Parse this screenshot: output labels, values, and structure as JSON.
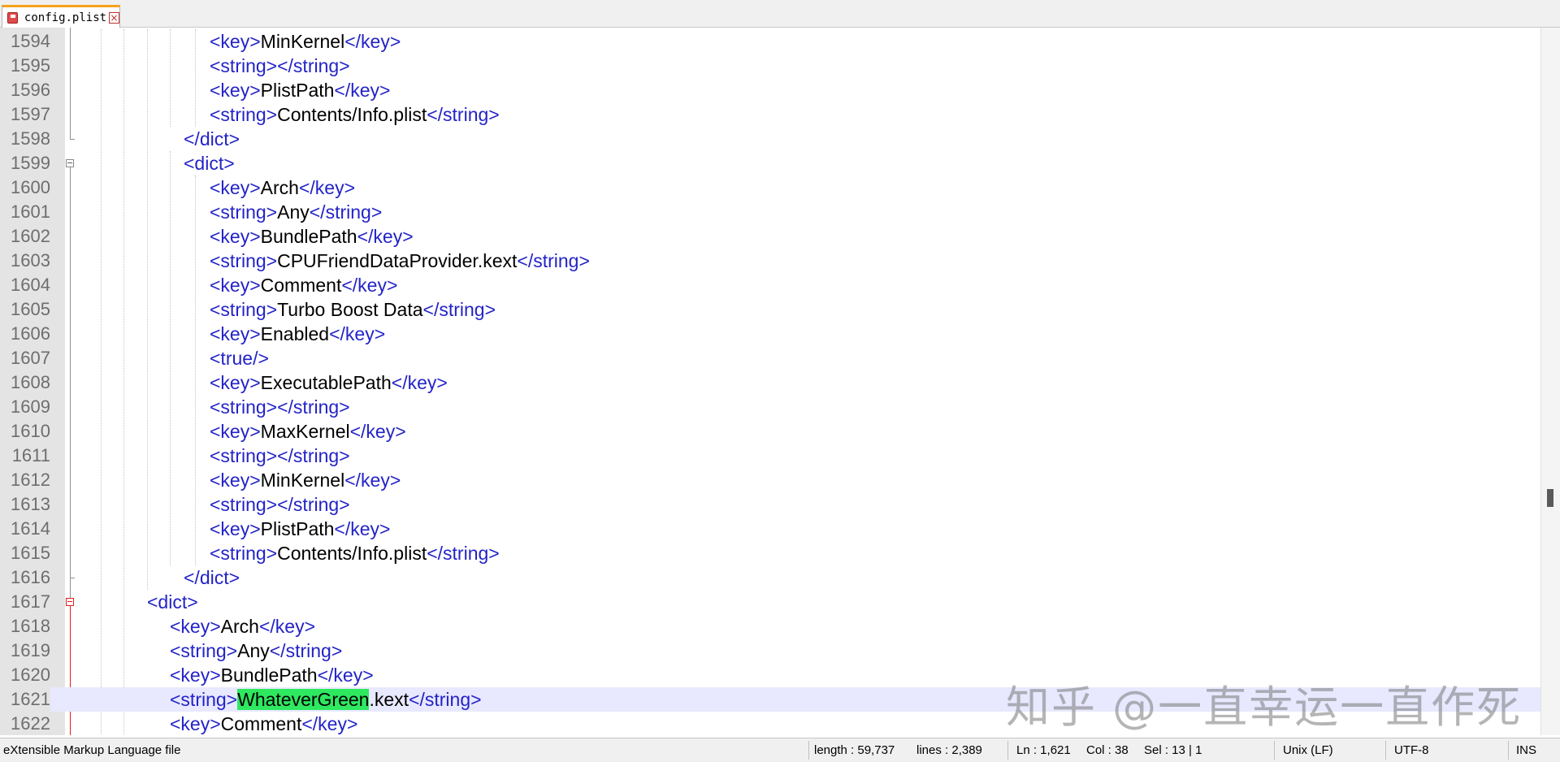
{
  "tab": {
    "label": "config.plist",
    "close": "×"
  },
  "editor": {
    "lines": [
      {
        "num": "1594",
        "indent": 3,
        "parts": [
          {
            "t": "tag",
            "v": "<key>"
          },
          {
            "t": "text",
            "v": "MinKernel"
          },
          {
            "t": "tag",
            "v": "</key>"
          }
        ]
      },
      {
        "num": "1595",
        "indent": 3,
        "parts": [
          {
            "t": "tag",
            "v": "<string></string>"
          }
        ]
      },
      {
        "num": "1596",
        "indent": 3,
        "parts": [
          {
            "t": "tag",
            "v": "<key>"
          },
          {
            "t": "text",
            "v": "PlistPath"
          },
          {
            "t": "tag",
            "v": "</key>"
          }
        ]
      },
      {
        "num": "1597",
        "indent": 3,
        "parts": [
          {
            "t": "tag",
            "v": "<string>"
          },
          {
            "t": "text",
            "v": "Contents/Info.plist"
          },
          {
            "t": "tag",
            "v": "</string>"
          }
        ]
      },
      {
        "num": "1598",
        "indent": 2,
        "parts": [
          {
            "t": "tag",
            "v": "</dict>"
          }
        ]
      },
      {
        "num": "1599",
        "indent": 2,
        "parts": [
          {
            "t": "tag",
            "v": "<dict>"
          }
        ]
      },
      {
        "num": "1600",
        "indent": 3,
        "parts": [
          {
            "t": "tag",
            "v": "<key>"
          },
          {
            "t": "text",
            "v": "Arch"
          },
          {
            "t": "tag",
            "v": "</key>"
          }
        ]
      },
      {
        "num": "1601",
        "indent": 3,
        "parts": [
          {
            "t": "tag",
            "v": "<string>"
          },
          {
            "t": "text",
            "v": "Any"
          },
          {
            "t": "tag",
            "v": "</string>"
          }
        ]
      },
      {
        "num": "1602",
        "indent": 3,
        "parts": [
          {
            "t": "tag",
            "v": "<key>"
          },
          {
            "t": "text",
            "v": "BundlePath"
          },
          {
            "t": "tag",
            "v": "</key>"
          }
        ]
      },
      {
        "num": "1603",
        "indent": 3,
        "parts": [
          {
            "t": "tag",
            "v": "<string>"
          },
          {
            "t": "text",
            "v": "CPUFriendDataProvider.kext"
          },
          {
            "t": "tag",
            "v": "</string>"
          }
        ]
      },
      {
        "num": "1604",
        "indent": 3,
        "parts": [
          {
            "t": "tag",
            "v": "<key>"
          },
          {
            "t": "text",
            "v": "Comment"
          },
          {
            "t": "tag",
            "v": "</key>"
          }
        ]
      },
      {
        "num": "1605",
        "indent": 3,
        "parts": [
          {
            "t": "tag",
            "v": "<string>"
          },
          {
            "t": "text",
            "v": "Turbo Boost Data"
          },
          {
            "t": "tag",
            "v": "</string>"
          }
        ]
      },
      {
        "num": "1606",
        "indent": 3,
        "parts": [
          {
            "t": "tag",
            "v": "<key>"
          },
          {
            "t": "text",
            "v": "Enabled"
          },
          {
            "t": "tag",
            "v": "</key>"
          }
        ]
      },
      {
        "num": "1607",
        "indent": 3,
        "parts": [
          {
            "t": "tag",
            "v": "<true/>"
          }
        ]
      },
      {
        "num": "1608",
        "indent": 3,
        "parts": [
          {
            "t": "tag",
            "v": "<key>"
          },
          {
            "t": "text",
            "v": "ExecutablePath"
          },
          {
            "t": "tag",
            "v": "</key>"
          }
        ]
      },
      {
        "num": "1609",
        "indent": 3,
        "parts": [
          {
            "t": "tag",
            "v": "<string></string>"
          }
        ]
      },
      {
        "num": "1610",
        "indent": 3,
        "parts": [
          {
            "t": "tag",
            "v": "<key>"
          },
          {
            "t": "text",
            "v": "MaxKernel"
          },
          {
            "t": "tag",
            "v": "</key>"
          }
        ]
      },
      {
        "num": "1611",
        "indent": 3,
        "parts": [
          {
            "t": "tag",
            "v": "<string></string>"
          }
        ]
      },
      {
        "num": "1612",
        "indent": 3,
        "parts": [
          {
            "t": "tag",
            "v": "<key>"
          },
          {
            "t": "text",
            "v": "MinKernel"
          },
          {
            "t": "tag",
            "v": "</key>"
          }
        ]
      },
      {
        "num": "1613",
        "indent": 3,
        "parts": [
          {
            "t": "tag",
            "v": "<string></string>"
          }
        ]
      },
      {
        "num": "1614",
        "indent": 3,
        "parts": [
          {
            "t": "tag",
            "v": "<key>"
          },
          {
            "t": "text",
            "v": "PlistPath"
          },
          {
            "t": "tag",
            "v": "</key>"
          }
        ]
      },
      {
        "num": "1615",
        "indent": 3,
        "parts": [
          {
            "t": "tag",
            "v": "<string>"
          },
          {
            "t": "text",
            "v": "Contents/Info.plist"
          },
          {
            "t": "tag",
            "v": "</string>"
          }
        ]
      },
      {
        "num": "1616",
        "indent": 2,
        "parts": [
          {
            "t": "tag",
            "v": "</dict>"
          }
        ]
      },
      {
        "num": "1617",
        "indent": 1,
        "parts": [
          {
            "t": "tag",
            "v": "<dict>"
          }
        ]
      },
      {
        "num": "1618",
        "indent": 0,
        "parts": [
          {
            "t": "tag",
            "v": "<key>"
          },
          {
            "t": "text",
            "v": "Arch"
          },
          {
            "t": "tag",
            "v": "</key>"
          }
        ]
      },
      {
        "num": "1619",
        "indent": 0,
        "parts": [
          {
            "t": "tag",
            "v": "<string>"
          },
          {
            "t": "text",
            "v": "Any"
          },
          {
            "t": "tag",
            "v": "</string>"
          }
        ]
      },
      {
        "num": "1620",
        "indent": 0,
        "parts": [
          {
            "t": "tag",
            "v": "<key>"
          },
          {
            "t": "text",
            "v": "BundlePath"
          },
          {
            "t": "tag",
            "v": "</key>"
          }
        ]
      },
      {
        "num": "1621",
        "indent": 0,
        "current": true,
        "parts": [
          {
            "t": "tag",
            "v": "<string>"
          },
          {
            "t": "hl",
            "v": "WhateverGreen"
          },
          {
            "t": "text",
            "v": ".kext"
          },
          {
            "t": "tag",
            "v": "</string>"
          }
        ]
      },
      {
        "num": "1622",
        "indent": 0,
        "parts": [
          {
            "t": "tag",
            "v": "<key>"
          },
          {
            "t": "text",
            "v": "Comment"
          },
          {
            "t": "tag",
            "v": "</key>"
          }
        ]
      }
    ]
  },
  "watermark": "知乎 @一直幸运一直作死",
  "status": {
    "filetype": "eXtensible Markup Language file",
    "length": "length : 59,737",
    "lines": "lines : 2,389",
    "ln": "Ln : 1,621",
    "col": "Col : 38",
    "sel": "Sel : 13 | 1",
    "eol": "Unix (LF)",
    "encoding": "UTF-8",
    "mode": "INS"
  }
}
